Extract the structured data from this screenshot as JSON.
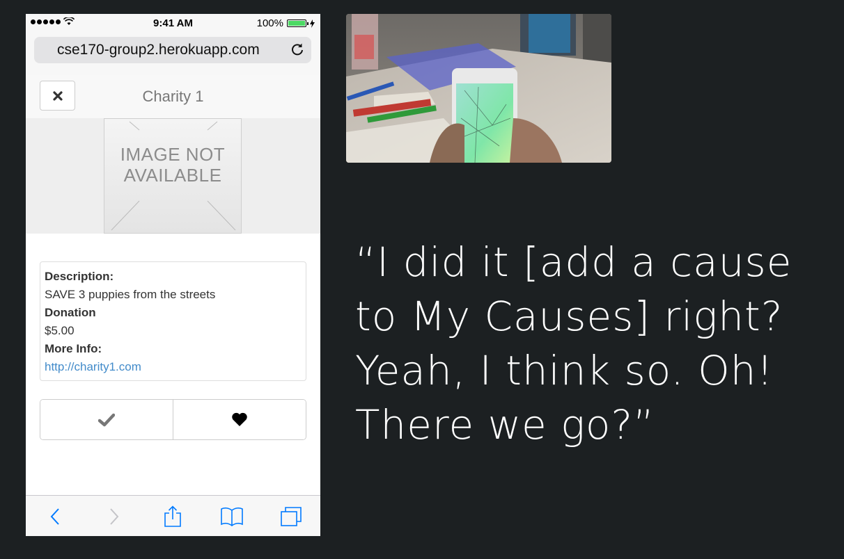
{
  "status_bar": {
    "time": "9:41 AM",
    "battery": "100%"
  },
  "browser": {
    "url": "cse170-group2.herokuapp.com"
  },
  "header": {
    "title": "Charity 1",
    "close_icon": "close-icon"
  },
  "image_placeholder": {
    "line1": "IMAGE NOT",
    "line2": "AVAILABLE"
  },
  "details": {
    "description_label": "Description:",
    "description_value": "SAVE 3 puppies from the streets",
    "donation_label": "Donation",
    "donation_value": "$5.00",
    "more_info_label": "More Info:",
    "more_info_link": "http://charity1.com"
  },
  "actions": {
    "check_icon": "checkmark-icon",
    "heart_icon": "heart-icon"
  },
  "toolbar": {
    "items": [
      "back-icon",
      "forward-icon",
      "share-icon",
      "bookmarks-icon",
      "tabs-icon"
    ]
  },
  "quote": {
    "text": "“I did it [add a cause to My Causes] right? Yeah, I think so. Oh! There we go?”"
  },
  "colors": {
    "background": "#1c2022",
    "link": "#428bca",
    "ios_blue": "#007aff",
    "battery_green": "#4cd964"
  }
}
